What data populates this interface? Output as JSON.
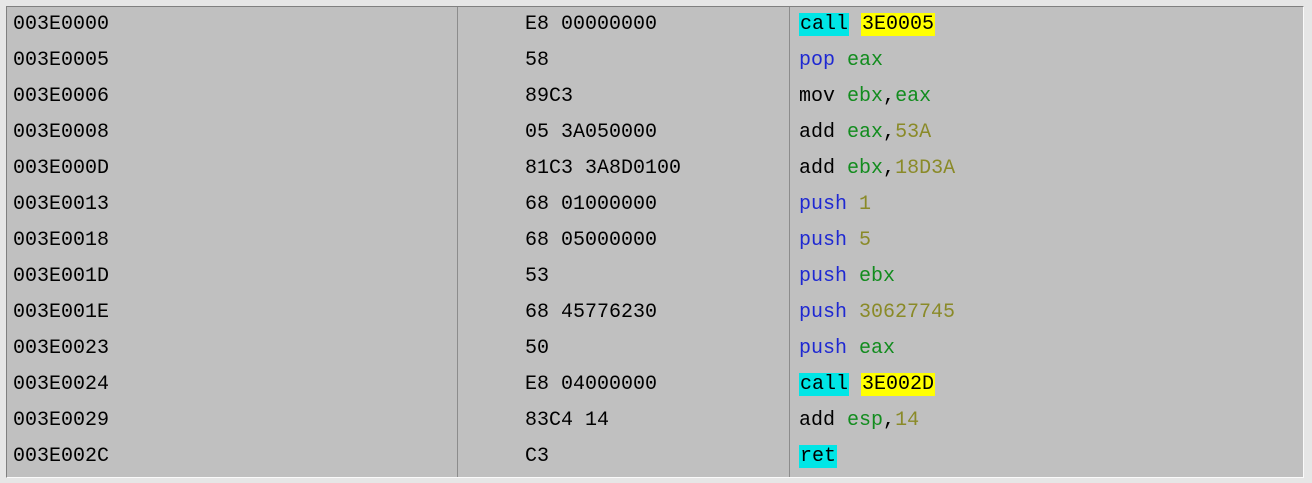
{
  "colors": {
    "panel_bg": "#c0c0c0",
    "page_bg": "#e6e6e6",
    "call_highlight": "#00e6e6",
    "target_highlight": "#ffff00",
    "stack_op": "#1e28d2",
    "register": "#128c1e",
    "immediate": "#8a8a28"
  },
  "rows": [
    {
      "address": "003E0000",
      "hex": "E8 00000000",
      "mnemonic": "call",
      "kind": "call",
      "ops": [
        {
          "t": "target",
          "v": "3E0005"
        }
      ]
    },
    {
      "address": "003E0005",
      "hex": "58",
      "mnemonic": "pop",
      "kind": "pop",
      "ops": [
        {
          "t": "reg",
          "v": "eax"
        }
      ]
    },
    {
      "address": "003E0006",
      "hex": "89C3",
      "mnemonic": "mov",
      "kind": "plain",
      "ops": [
        {
          "t": "reg",
          "v": "ebx"
        },
        {
          "t": "sep",
          "v": ","
        },
        {
          "t": "reg",
          "v": "eax"
        }
      ]
    },
    {
      "address": "003E0008",
      "hex": "05 3A050000",
      "mnemonic": "add",
      "kind": "plain",
      "ops": [
        {
          "t": "reg",
          "v": "eax"
        },
        {
          "t": "sep",
          "v": ","
        },
        {
          "t": "imm",
          "v": "53A"
        }
      ]
    },
    {
      "address": "003E000D",
      "hex": "81C3 3A8D0100",
      "mnemonic": "add",
      "kind": "plain",
      "ops": [
        {
          "t": "reg",
          "v": "ebx"
        },
        {
          "t": "sep",
          "v": ","
        },
        {
          "t": "imm",
          "v": "18D3A"
        }
      ]
    },
    {
      "address": "003E0013",
      "hex": "68 01000000",
      "mnemonic": "push",
      "kind": "push",
      "ops": [
        {
          "t": "imm",
          "v": "1"
        }
      ]
    },
    {
      "address": "003E0018",
      "hex": "68 05000000",
      "mnemonic": "push",
      "kind": "push",
      "ops": [
        {
          "t": "imm",
          "v": "5"
        }
      ]
    },
    {
      "address": "003E001D",
      "hex": "53",
      "mnemonic": "push",
      "kind": "push",
      "ops": [
        {
          "t": "reg",
          "v": "ebx"
        }
      ]
    },
    {
      "address": "003E001E",
      "hex": "68 45776230",
      "mnemonic": "push",
      "kind": "push",
      "ops": [
        {
          "t": "imm",
          "v": "30627745"
        }
      ]
    },
    {
      "address": "003E0023",
      "hex": "50",
      "mnemonic": "push",
      "kind": "push",
      "ops": [
        {
          "t": "reg",
          "v": "eax"
        }
      ]
    },
    {
      "address": "003E0024",
      "hex": "E8 04000000",
      "mnemonic": "call",
      "kind": "call",
      "ops": [
        {
          "t": "target",
          "v": "3E002D"
        }
      ]
    },
    {
      "address": "003E0029",
      "hex": "83C4 14",
      "mnemonic": "add",
      "kind": "plain",
      "ops": [
        {
          "t": "reg",
          "v": "esp"
        },
        {
          "t": "sep",
          "v": ","
        },
        {
          "t": "imm",
          "v": "14"
        }
      ]
    },
    {
      "address": "003E002C",
      "hex": "C3",
      "mnemonic": "ret",
      "kind": "ret",
      "ops": []
    }
  ]
}
